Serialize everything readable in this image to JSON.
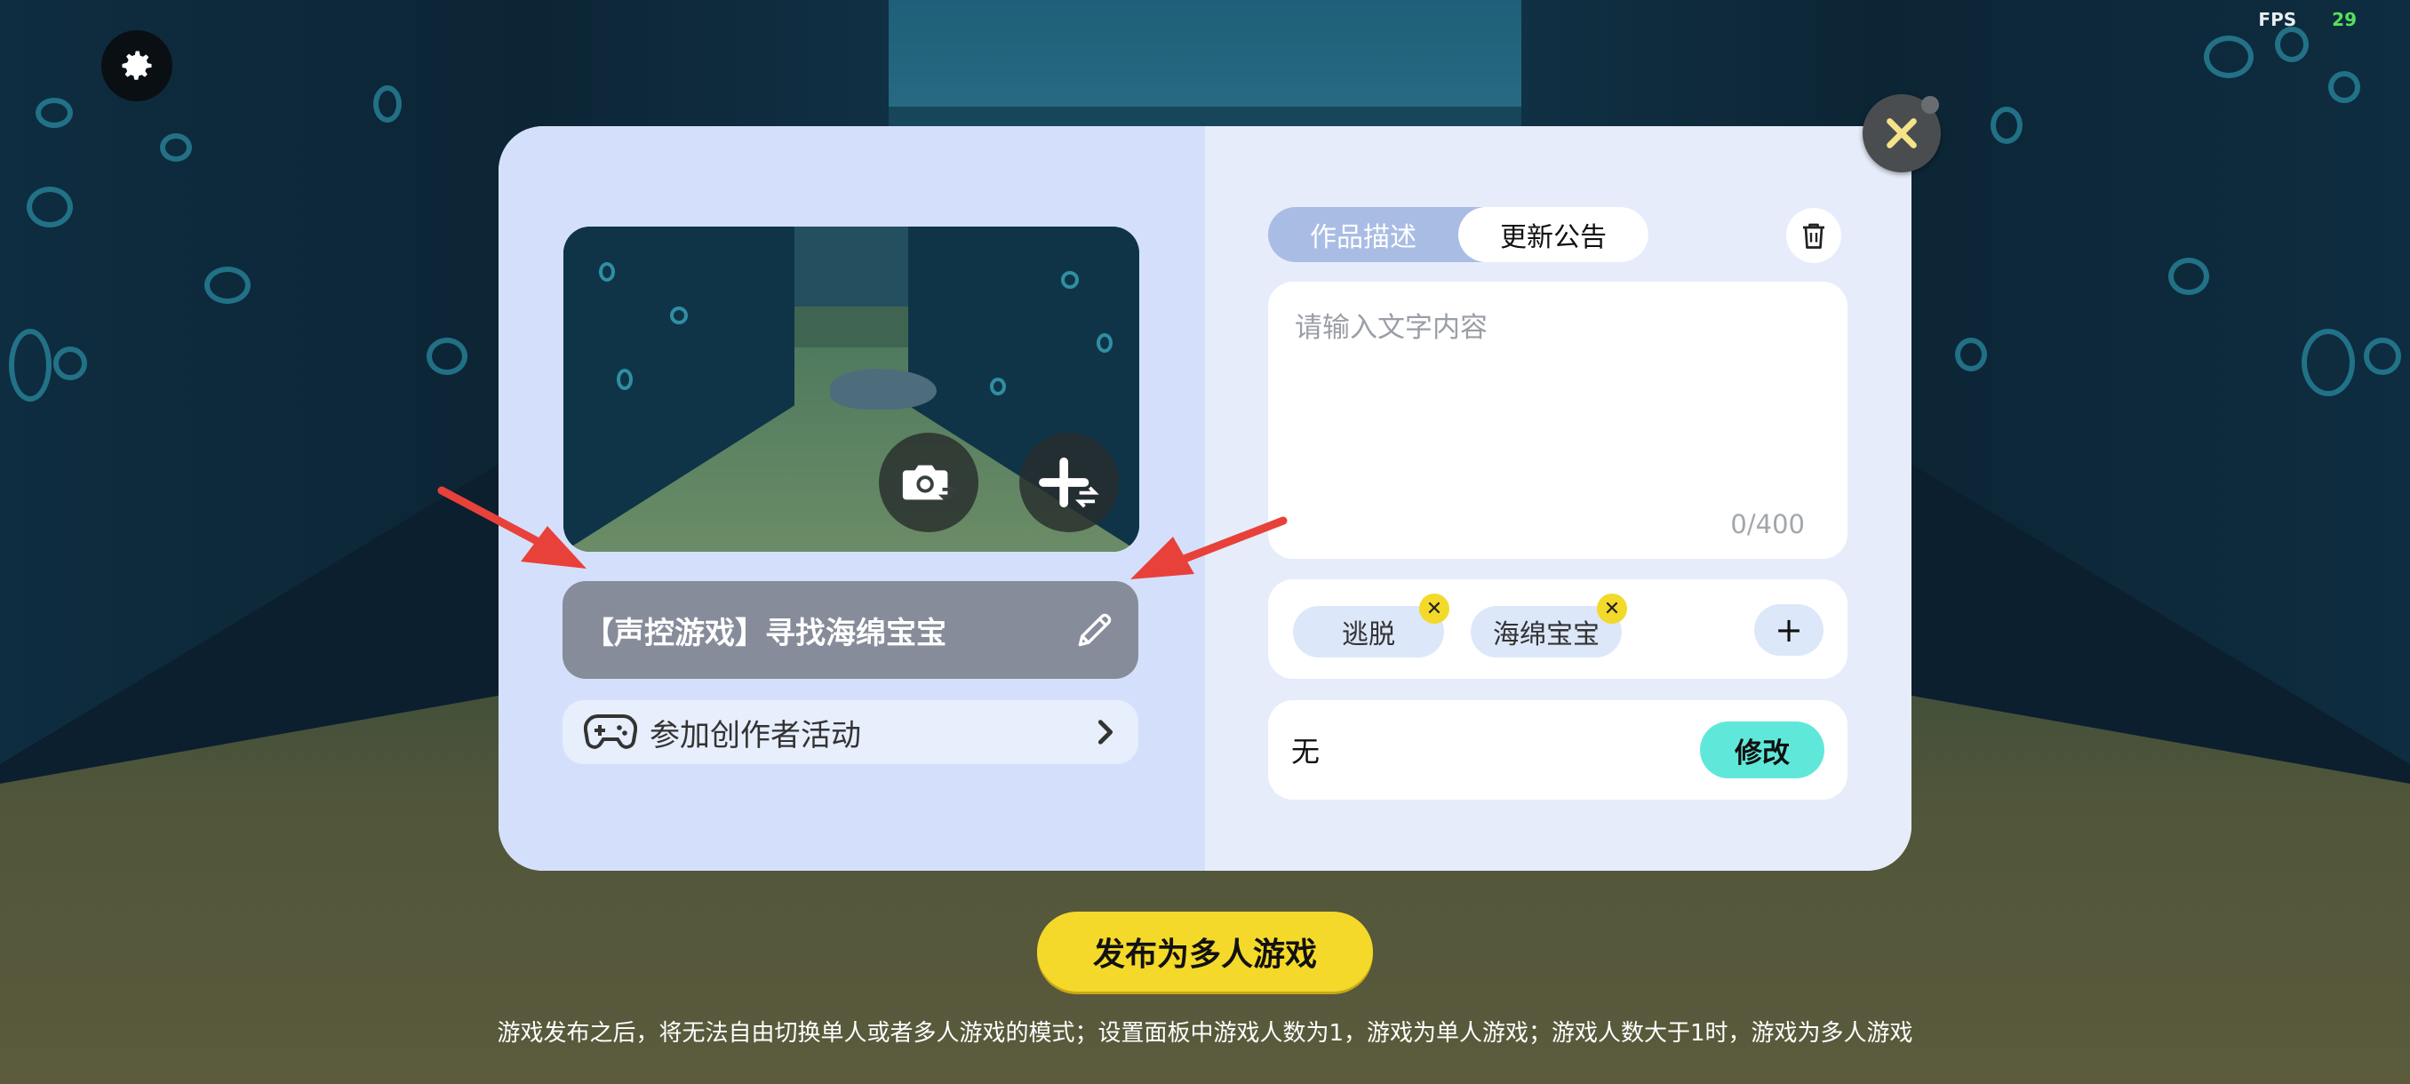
{
  "hud": {
    "fps_label": "FPS",
    "fps_value": "29",
    "settings_icon": "gear-icon"
  },
  "cover": {
    "camera_icon": "camera-switch-icon",
    "add_icon": "add-swap-icon"
  },
  "game": {
    "title": "【声控游戏】寻找海绵宝宝",
    "edit_icon": "pencil-icon"
  },
  "activity": {
    "label": "参加创作者活动",
    "icon": "gamepad-icon",
    "arrow_icon": "chevron-right-icon"
  },
  "tabs": [
    {
      "label": "作品描述",
      "active": false
    },
    {
      "label": "更新公告",
      "active": true
    }
  ],
  "description": {
    "placeholder": "请输入文字内容",
    "count": "0/400"
  },
  "tags": [
    {
      "label": "逃脱"
    },
    {
      "label": "海绵宝宝"
    }
  ],
  "tag_add_label": "+",
  "room": {
    "value": "无",
    "modify_label": "修改"
  },
  "publish": {
    "label": "发布为多人游戏",
    "hint": "游戏发布之后，将无法自由切换单人或者多人游戏的模式；设置面板中游戏人数为1，游戏为单人游戏；游戏人数大于1时，游戏为多人游戏"
  },
  "colors": {
    "accent_yellow": "#f5d92a",
    "accent_cyan": "#5fe8da",
    "arrow_red": "#e8413a"
  }
}
